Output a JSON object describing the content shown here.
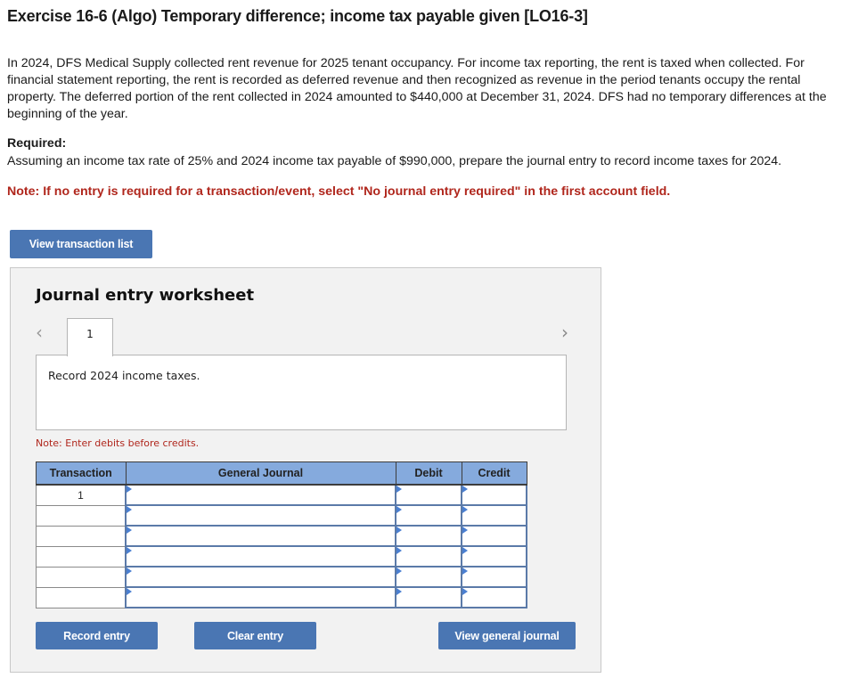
{
  "header": {
    "title": "Exercise 16-6 (Algo) Temporary difference; income tax payable given [LO16-3]"
  },
  "problem": {
    "paragraph": "In 2024, DFS Medical Supply collected rent revenue for 2025 tenant occupancy. For income tax reporting, the rent is taxed when collected. For financial statement reporting, the rent is recorded as deferred revenue and then recognized as revenue in the period tenants occupy the rental property. The deferred portion of the rent collected in 2024 amounted to $440,000 at December 31, 2024. DFS had no temporary differences at the beginning of the year.",
    "required_label": "Required:",
    "required_text": "Assuming an income tax rate of 25% and 2024 income tax payable of $990,000, prepare the journal entry to record income taxes for 2024.",
    "note": "Note: If no entry is required for a transaction/event, select \"No journal entry required\" in the first account field."
  },
  "buttons": {
    "view_transaction_list": "View transaction list",
    "record_entry": "Record entry",
    "clear_entry": "Clear entry",
    "view_general_journal": "View general journal"
  },
  "worksheet": {
    "title": "Journal entry worksheet",
    "prev_icon": "‹",
    "next_icon": "›",
    "active_tab": "1",
    "description": "Record 2024 income taxes.",
    "note": "Note: Enter debits before credits.",
    "columns": [
      "Transaction",
      "General Journal",
      "Debit",
      "Credit"
    ],
    "rows": [
      {
        "transaction": "1",
        "account": "",
        "debit": "",
        "credit": ""
      },
      {
        "transaction": "",
        "account": "",
        "debit": "",
        "credit": ""
      },
      {
        "transaction": "",
        "account": "",
        "debit": "",
        "credit": ""
      },
      {
        "transaction": "",
        "account": "",
        "debit": "",
        "credit": ""
      },
      {
        "transaction": "",
        "account": "",
        "debit": "",
        "credit": ""
      },
      {
        "transaction": "",
        "account": "",
        "debit": "",
        "credit": ""
      }
    ]
  },
  "colors": {
    "button_blue": "#4a76b3",
    "header_blue": "#85aadd",
    "note_red": "#b0261c",
    "panel_bg": "#f2f2f2"
  }
}
